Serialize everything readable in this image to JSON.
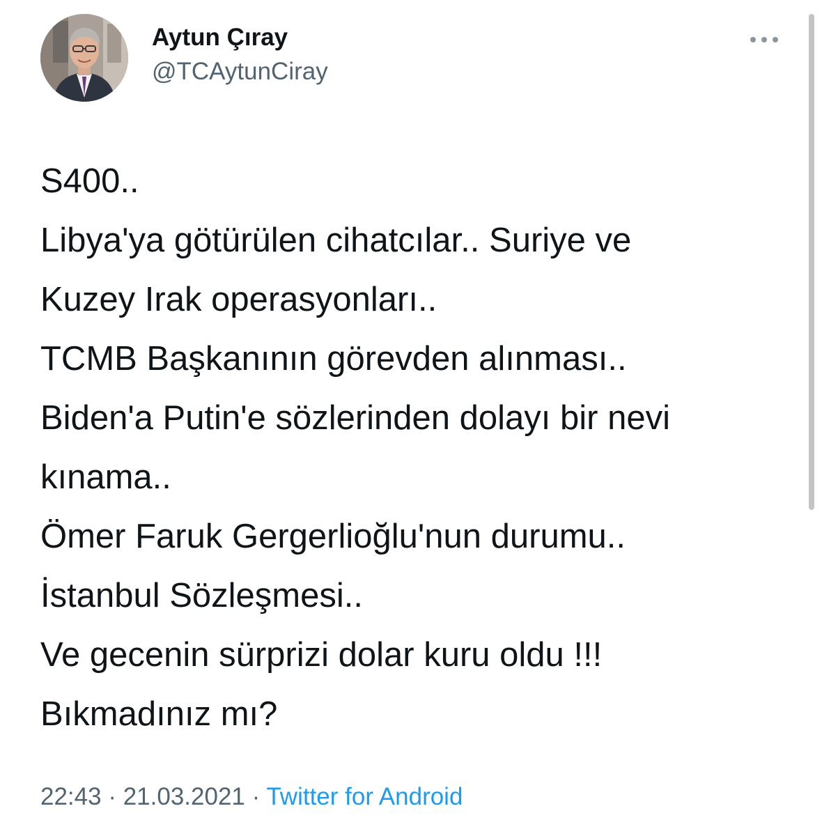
{
  "author": {
    "display_name": "Aytun Çıray",
    "handle": "@TCAytunCiray"
  },
  "tweet": {
    "lines": [
      "S400..",
      "Libya'ya götürülen cihatcılar.. Suriye ve",
      "Kuzey Irak operasyonları..",
      "TCMB Başkanının görevden alınması..",
      "Biden'a Putin'e sözlerinden dolayı bir nevi",
      "kınama..",
      "Ömer Faruk Gergerlioğlu'nun durumu..",
      "İstanbul Sözleşmesi..",
      "Ve gecenin sürprizi dolar kuru oldu !!!",
      "Bıkmadınız mı?"
    ]
  },
  "meta": {
    "time": "22:43",
    "separator": " · ",
    "date": "21.03.2021",
    "source": "Twitter for Android"
  },
  "icons": {
    "more": "more-horizontal-icon"
  },
  "colors": {
    "text": "#0f1419",
    "secondary": "#536471",
    "link": "#1d9bf0"
  }
}
